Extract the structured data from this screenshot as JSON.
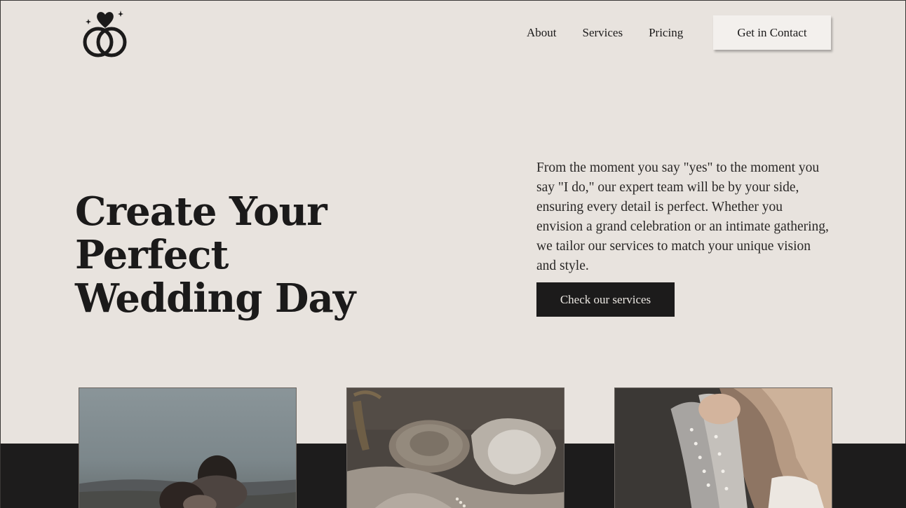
{
  "brand": {
    "logo_icon": "wedding-rings-heart-icon"
  },
  "nav": {
    "links": [
      "About",
      "Services",
      "Pricing"
    ],
    "cta_label": "Get in Contact"
  },
  "hero": {
    "title_line1": "Create Your Perfect",
    "title_line2": "Wedding Day",
    "description": "From the moment you say \"yes\" to the moment you say \"I do,\" our expert team will be by your side, ensuring every detail is perfect. Whether you envision a grand celebration or an intimate gathering, we tailor our services to match your unique vision and style.",
    "button_label": "Check our services"
  },
  "gallery": {
    "images": [
      "couple-on-beach-photo",
      "wedding-details-photo",
      "bride-pearl-gloves-photo"
    ]
  },
  "colors": {
    "background": "#e8e3de",
    "dark": "#1d1c1c",
    "text": "#1b1a1a"
  }
}
